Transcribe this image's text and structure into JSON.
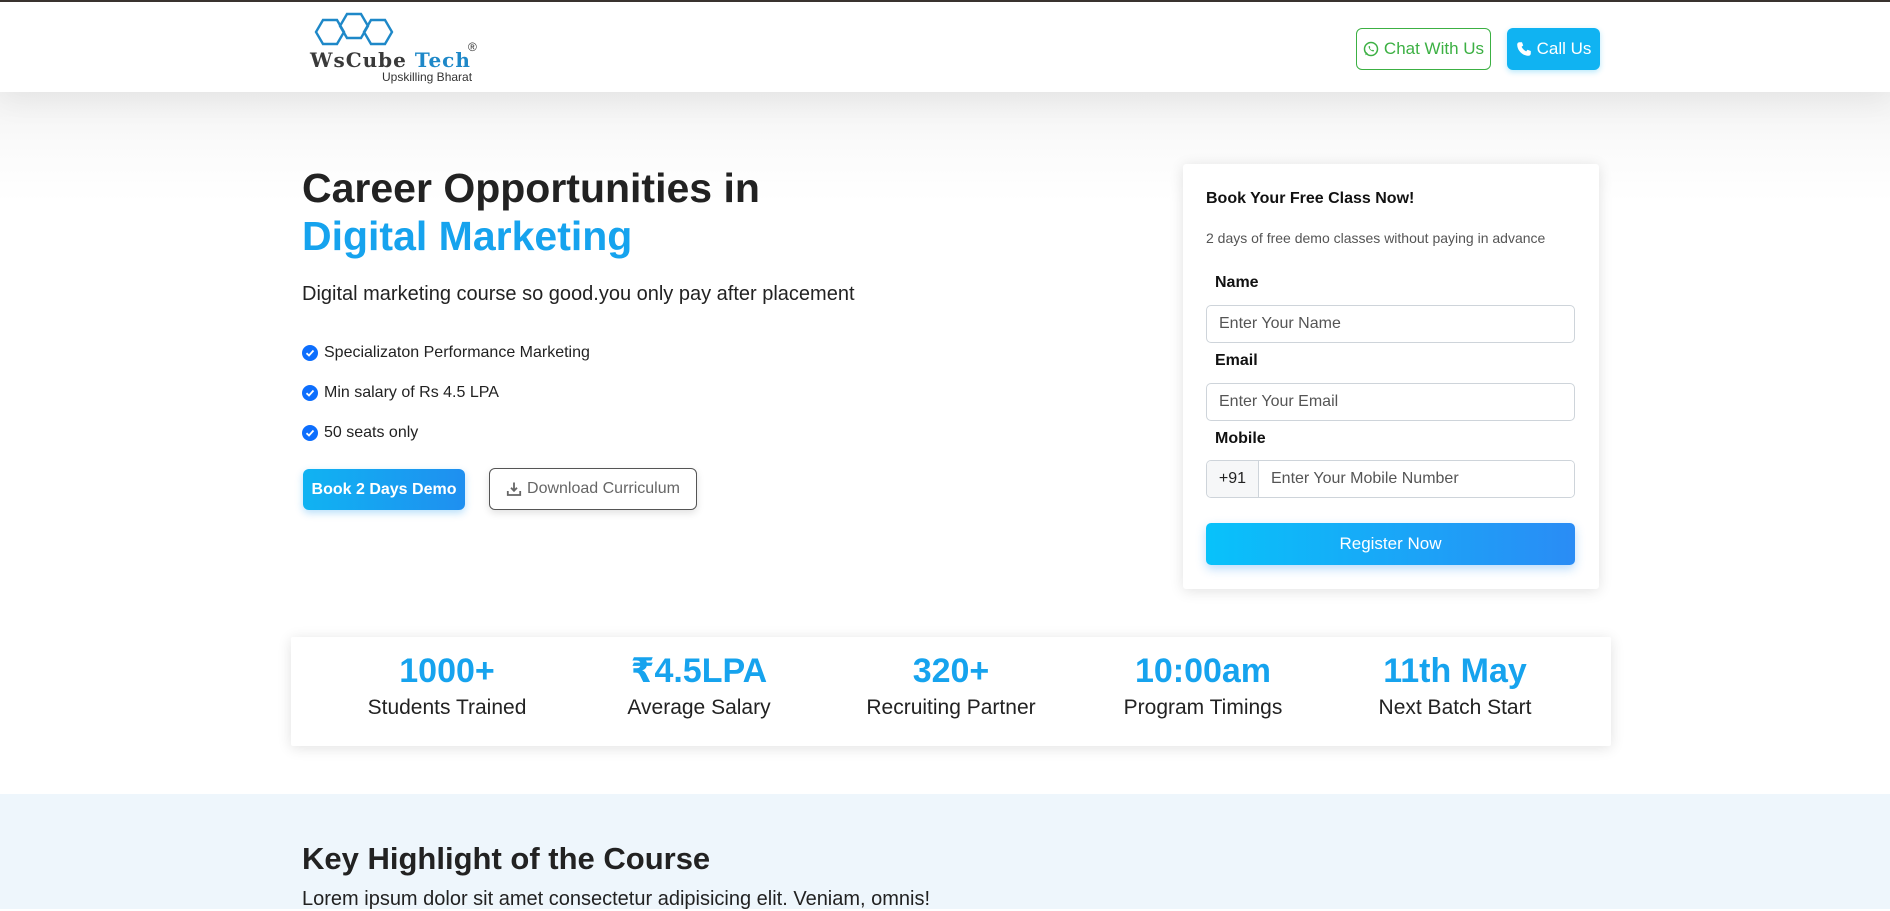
{
  "brand": {
    "name_part1": "WsCube",
    "name_part2": "Tech",
    "registered": "®",
    "tagline": "Upskilling Bharat"
  },
  "header": {
    "chat_label": "Chat With Us",
    "call_label": "Call Us"
  },
  "hero": {
    "title_line1": "Career Opportunities in",
    "title_line2": "Digital Marketing",
    "subtitle": "Digital marketing course so good.you only pay after placement",
    "bullets": [
      "Specializaton Performance Marketing",
      "Min salary of Rs 4.5 LPA",
      "50 seats only"
    ],
    "demo_button": "Book 2 Days Demo",
    "download_button": "Download Curriculum"
  },
  "form": {
    "title": "Book Your Free Class Now!",
    "subtitle": "2 days of free demo classes without paying in advance",
    "name_label": "Name",
    "name_placeholder": "Enter Your Name",
    "email_label": "Email",
    "email_placeholder": "Enter Your Email",
    "mobile_label": "Mobile",
    "country_code": "+91",
    "mobile_placeholder": "Enter Your Mobile Number",
    "register_button": "Register Now"
  },
  "stats": [
    {
      "value": "1000+",
      "label": "Students Trained"
    },
    {
      "value": "₹4.5LPA",
      "label": "Average Salary"
    },
    {
      "value": "320+",
      "label": "Recruiting Partner"
    },
    {
      "value": "10:00am",
      "label": "Program Timings"
    },
    {
      "value": "11th May",
      "label": "Next Batch Start"
    }
  ],
  "highlights": {
    "title": "Key Highlight of the Course",
    "text": "Lorem ipsum dolor sit amet consectetur adipisicing elit. Veniam, omnis!"
  },
  "colors": {
    "accent": "#16a3ee",
    "chat_green": "#3cb043",
    "call_blue": "#10b3f2",
    "check_blue": "#0d6efd",
    "highlight_bg": "#eef6fc"
  },
  "icons": {
    "chat": "whatsapp-icon",
    "call": "phone-icon",
    "download": "download-icon",
    "bullet": "check-circle-icon"
  }
}
